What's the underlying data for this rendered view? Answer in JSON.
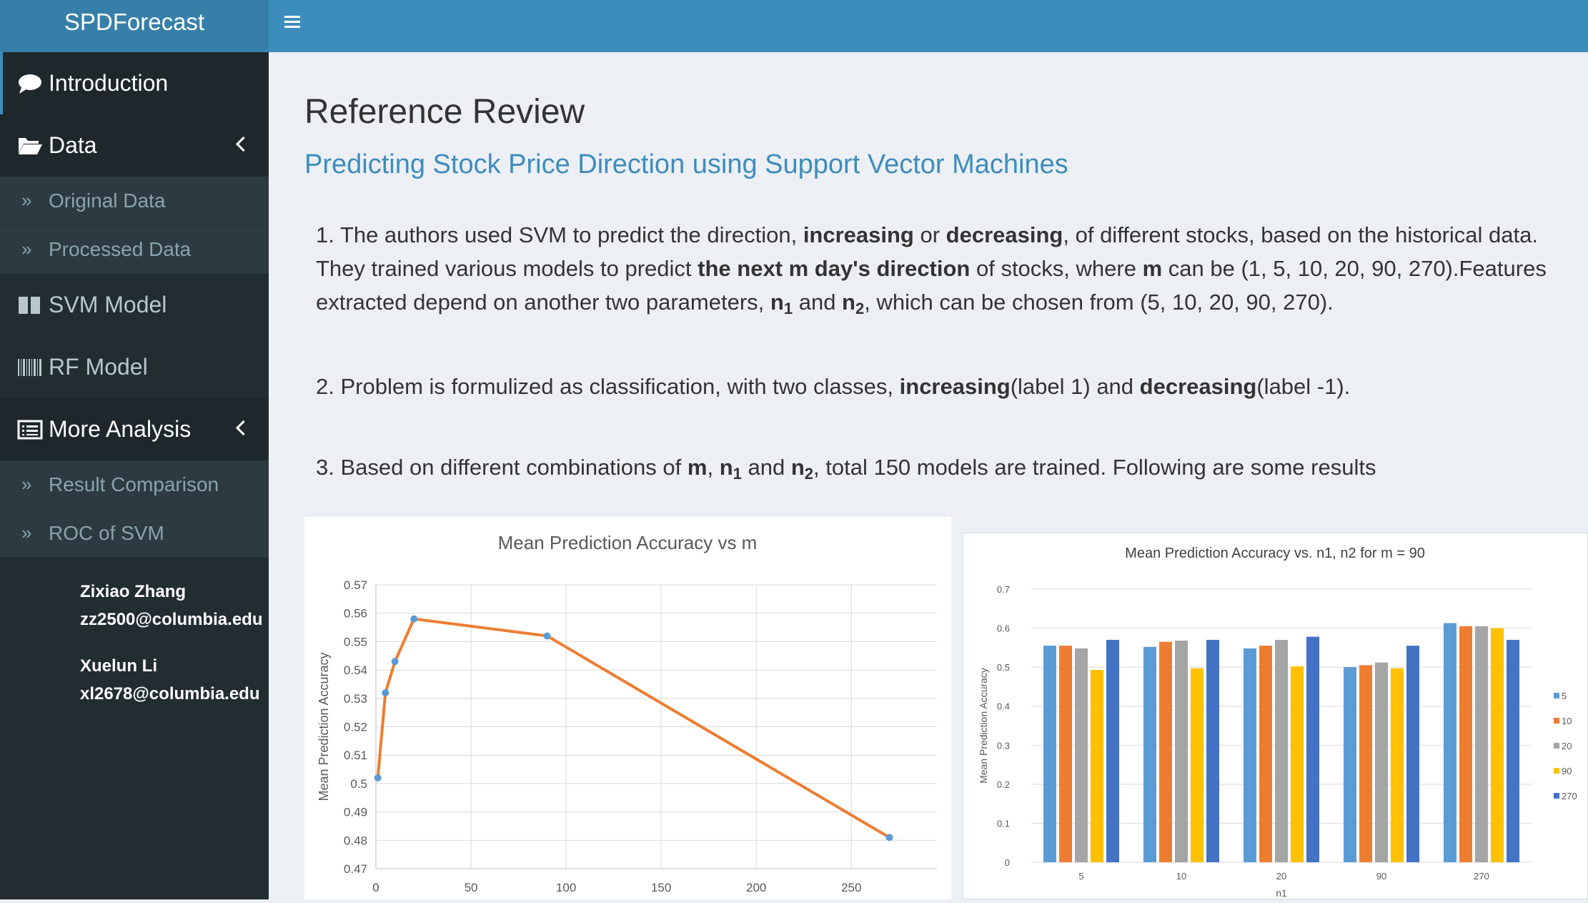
{
  "app": {
    "brand": "SPDForecast"
  },
  "sidebar": {
    "items": [
      {
        "label": "Introduction",
        "icon": "comment-icon"
      },
      {
        "label": "Data",
        "icon": "folder-open-icon"
      },
      {
        "label": "Original Data",
        "icon": "double-chevron-icon"
      },
      {
        "label": "Processed Data",
        "icon": "double-chevron-icon"
      },
      {
        "label": "SVM Model",
        "icon": "columns-icon"
      },
      {
        "label": "RF Model",
        "icon": "barcode-icon"
      },
      {
        "label": "More Analysis",
        "icon": "list-alt-icon"
      },
      {
        "label": "Result Comparison",
        "icon": "double-chevron-icon"
      },
      {
        "label": "ROC of SVM",
        "icon": "double-chevron-icon"
      }
    ],
    "authors": [
      {
        "name": "Zixiao Zhang",
        "email": "zz2500@columbia.edu"
      },
      {
        "name": "Xuelun Li",
        "email": "xl2678@columbia.edu"
      }
    ]
  },
  "main": {
    "title": "Reference Review",
    "subtitle": "Predicting Stock Price Direction using Support Vector Machines",
    "p1": {
      "a": "1. The authors used SVM to predict the direction, ",
      "b": "increasing",
      "c": " or ",
      "d": "decreasing",
      "e": ", of different stocks, based on the historical data. They trained various models to predict ",
      "f": "the next m day's direction",
      "g": " of stocks, where ",
      "h": "m",
      "i": " can be (1, 5, 10, 20, 90, 270).Features extracted depend on another two parameters, ",
      "j": "n",
      "j_sub": "1",
      "k": " and ",
      "l": "n",
      "l_sub": "2",
      "m": ", which can be chosen from (5, 10, 20, 90, 270)."
    },
    "p2": {
      "a": "2. Problem is formulized as classification, with two classes, ",
      "b": "increasing",
      "c": "(label 1) and ",
      "d": "decreasing",
      "e": "(label -1)."
    },
    "p3": {
      "a": "3. Based on different combinations of ",
      "b": "m",
      "c": ", ",
      "d": "n",
      "d_sub": "1",
      "e": " and ",
      "f": "n",
      "f_sub": "2",
      "g": ", total 150 models are trained. Following are some results"
    }
  },
  "chart_data": [
    {
      "type": "line",
      "title": "Mean Prediction Accuracy vs m",
      "xlabel": "",
      "ylabel": "Mean Prediction Accuracy",
      "x": [
        1,
        5,
        10,
        20,
        90,
        270
      ],
      "y": [
        0.502,
        0.532,
        0.543,
        0.558,
        0.552,
        0.481
      ],
      "xticks": [
        0,
        50,
        100,
        150,
        200,
        250
      ],
      "yticks": [
        0.47,
        0.48,
        0.49,
        0.5,
        0.51,
        0.52,
        0.53,
        0.54,
        0.55,
        0.56,
        0.57
      ],
      "ylim": [
        0.47,
        0.57
      ],
      "xlim": [
        0,
        295
      ],
      "grid": true,
      "color": "#ed7d31",
      "marker_color": "#5b9bd5"
    },
    {
      "type": "bar",
      "title": "Mean Prediction Accuracy vs. n1, n2 for m = 90",
      "xlabel": "n1",
      "ylabel": "Mean Prediction Accuracy",
      "categories": [
        "5",
        "10",
        "20",
        "90",
        "270"
      ],
      "yticks": [
        0,
        0.1,
        0.2,
        0.3,
        0.4,
        0.5,
        0.6,
        0.7
      ],
      "ylim": [
        0,
        0.7
      ],
      "legend_position": "right",
      "series": [
        {
          "name": "5",
          "color": "#5b9bd5",
          "values": [
            0.555,
            0.552,
            0.548,
            0.5,
            0.613
          ]
        },
        {
          "name": "10",
          "color": "#ed7d31",
          "values": [
            0.555,
            0.565,
            0.555,
            0.505,
            0.605
          ]
        },
        {
          "name": "20",
          "color": "#a5a5a5",
          "values": [
            0.548,
            0.568,
            0.57,
            0.512,
            0.605
          ]
        },
        {
          "name": "90",
          "color": "#ffc000",
          "values": [
            0.493,
            0.497,
            0.502,
            0.497,
            0.6
          ]
        },
        {
          "name": "270",
          "color": "#4472c4",
          "values": [
            0.57,
            0.57,
            0.578,
            0.555,
            0.57
          ]
        }
      ]
    }
  ]
}
